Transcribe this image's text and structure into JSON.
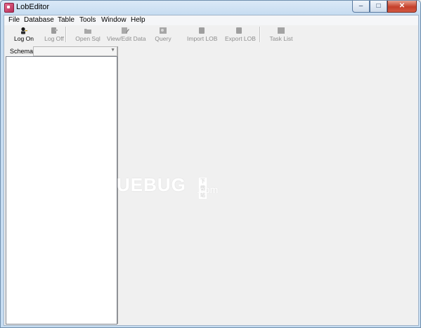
{
  "window": {
    "title": "LobEditor",
    "minimize_glyph": "–",
    "maximize_glyph": "□",
    "close_glyph": "✕"
  },
  "menu": {
    "items": [
      {
        "label": "File"
      },
      {
        "label": "Database"
      },
      {
        "label": "Table"
      },
      {
        "label": "Tools"
      },
      {
        "label": "Window"
      },
      {
        "label": "Help"
      }
    ]
  },
  "toolbar": {
    "buttons": [
      {
        "label": "Log On",
        "icon": "user-key-icon",
        "enabled": true
      },
      {
        "label": "Log Off",
        "icon": "user-logoff-icon",
        "enabled": false
      },
      {
        "label": "Open Sql",
        "icon": "folder-open-icon",
        "enabled": false
      },
      {
        "label": "View/Edit Data",
        "icon": "edit-data-icon",
        "enabled": false
      },
      {
        "label": "Query",
        "icon": "query-icon",
        "enabled": false
      },
      {
        "label": "Import LOB",
        "icon": "import-icon",
        "enabled": false
      },
      {
        "label": "Export LOB",
        "icon": "export-icon",
        "enabled": false
      },
      {
        "label": "Task List",
        "icon": "task-list-icon",
        "enabled": false
      }
    ]
  },
  "schema": {
    "label": "Schema",
    "selected": ""
  },
  "watermark": {
    "text": "UEBUG",
    "tag": "下载站",
    "domain": ".com"
  },
  "colors": {
    "titlebar": "#c6dcf1",
    "client_bg": "#f0f0f0",
    "tree_bg": "#ffffff",
    "disabled_text": "#8d8d8d"
  }
}
